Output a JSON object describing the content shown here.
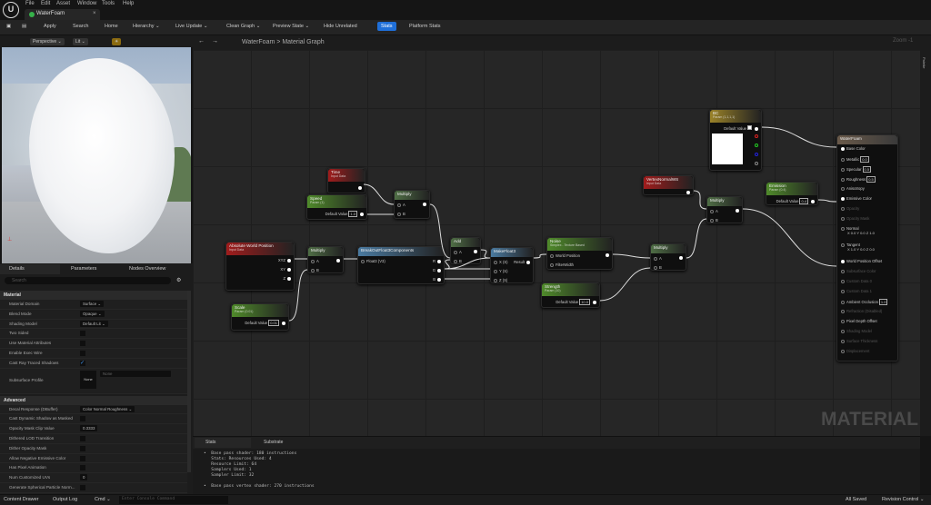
{
  "menu": [
    "File",
    "Edit",
    "Asset",
    "Window",
    "Tools",
    "Help"
  ],
  "tab": {
    "title": "WaterFoam"
  },
  "toolbar": [
    "Apply",
    "Search",
    "Home",
    "Hierarchy ⌄",
    "Live Update ⌄",
    "Clean Graph ⌄",
    "Preview State ⌄",
    "Hide Unrelated"
  ],
  "toolbar_stats": "Stats",
  "toolbar_platform": "Platform Stats",
  "viewport": {
    "perspective": "Perspective ⌄",
    "lit": "Lit ⌄"
  },
  "panels": {
    "details": "Details",
    "parameters": "Parameters",
    "nodes_overview": "Nodes Overview",
    "search_placeholder": "Search"
  },
  "details": {
    "material_section": "Material",
    "material_rows": [
      {
        "label": "Material Domain",
        "value": "Surface ⌄"
      },
      {
        "label": "Blend Mode",
        "value": "Opaque ⌄"
      },
      {
        "label": "Shading Model",
        "value": "Default Lit ⌄"
      },
      {
        "label": "Two Sided",
        "checked": false
      },
      {
        "label": "Use Material Attributes",
        "checked": false
      },
      {
        "label": "Enable Exec Wire",
        "checked": false
      },
      {
        "label": "Cast Ray Traced Shadows",
        "checked": true
      }
    ],
    "subsurface": {
      "label": "Subsurface Profile",
      "thumb": "None",
      "value": "None"
    },
    "advanced_section": "Advanced",
    "advanced_rows": [
      {
        "label": "Decal Response (DBuffer)",
        "value": "Color Normal Roughness ⌄"
      },
      {
        "label": "Cast Dynamic Shadow as Masked",
        "checked": false
      },
      {
        "label": "Opacity Mask Clip Value",
        "value": "0.3333"
      },
      {
        "label": "Dithered LOD Transition",
        "checked": false
      },
      {
        "label": "Dither Opacity Mask",
        "checked": false
      },
      {
        "label": "Allow Negative Emissive Color",
        "checked": false
      },
      {
        "label": "Has Pixel Animation",
        "checked": false
      },
      {
        "label": "Num Customized UVs",
        "value": "0"
      },
      {
        "label": "Generate Spherical Particle Norm...",
        "checked": false
      },
      {
        "label": "Tangent Space Normal",
        "checked": true
      }
    ]
  },
  "graph": {
    "breadcrumb_asset": "WaterFoam",
    "breadcrumb_sep": ">",
    "breadcrumb_graph": "Material Graph",
    "zoom": "Zoom -1",
    "watermark": "MATERIAL",
    "palette": "Palette"
  },
  "nodes": [
    {
      "id": "time",
      "title": "Time",
      "subtitle": "Input Data",
      "color": "#a01c1c"
    },
    {
      "id": "speed",
      "title": "Speed",
      "subtitle": "Param (1)",
      "color": "#4f8a2a",
      "default": "1.0"
    },
    {
      "id": "mul1",
      "title": "Multiply",
      "color": "#4f6e45",
      "pins": [
        "A",
        "B"
      ]
    },
    {
      "id": "awp",
      "title": "Absolute World Position",
      "subtitle": "Input Data",
      "color": "#a01c1c",
      "outs": [
        "XYZ",
        "XY",
        "Z"
      ]
    },
    {
      "id": "mul2",
      "title": "Multiply",
      "color": "#4f6e45",
      "pins": [
        "A",
        "B"
      ]
    },
    {
      "id": "break",
      "title": "BreakOutFloat3Components",
      "color": "#4a7aa0",
      "pins": [
        "Float3 (V3)"
      ],
      "outs": [
        "R",
        "G",
        "B"
      ]
    },
    {
      "id": "scale",
      "title": "Scale",
      "subtitle": "Param (0.01)",
      "color": "#4f8a2a",
      "default": "0.01"
    },
    {
      "id": "add",
      "title": "Add",
      "color": "#4f6e45",
      "pins": [
        "A",
        "B"
      ]
    },
    {
      "id": "make",
      "title": "MakeFloat3",
      "color": "#4a7aa0",
      "pins": [
        "X (S)",
        "Y (S)",
        "Z (S)"
      ],
      "outs": [
        "Result"
      ]
    },
    {
      "id": "noise",
      "title": "Noise",
      "subtitle": "Simplex - Texture Based",
      "color": "#4f8a2a",
      "pins": [
        "World Position",
        "FilterWidth"
      ]
    },
    {
      "id": "strength",
      "title": "Strength",
      "subtitle": "Param (10)",
      "color": "#4f8a2a",
      "default": "10.0"
    },
    {
      "id": "mul3",
      "title": "Multiply",
      "color": "#4f6e45",
      "pins": [
        "A",
        "B"
      ]
    },
    {
      "id": "bc",
      "title": "BC",
      "subtitle": "Param (1,1,1,1)",
      "color": "#9a8228",
      "default": ""
    },
    {
      "id": "vnws",
      "title": "VertexNormalWS",
      "subtitle": "Input Data",
      "color": "#a01c1c"
    },
    {
      "id": "mul4",
      "title": "Multiply",
      "color": "#4f6e45",
      "pins": [
        "A",
        "B"
      ]
    },
    {
      "id": "emission",
      "title": "Emission",
      "subtitle": "Param (0.4)",
      "color": "#4f8a2a",
      "default": "0.4"
    }
  ],
  "default_value_label": "Default Value",
  "result_node": {
    "title": "WaterFoam",
    "pins": [
      {
        "label": "Base Color",
        "on": true
      },
      {
        "label": "Metallic",
        "on": true,
        "v": "0.0"
      },
      {
        "label": "Specular",
        "on": true,
        "v": "0.5"
      },
      {
        "label": "Roughness",
        "on": true,
        "v": "0.5"
      },
      {
        "label": "Anisotropy",
        "on": true
      },
      {
        "label": "Emissive Color",
        "on": true
      },
      {
        "label": "Opacity",
        "on": false
      },
      {
        "label": "Opacity Mask",
        "on": false
      },
      {
        "label": "Normal",
        "on": true,
        "v": "X 0.0 Y 0.0 Z 1.0"
      },
      {
        "label": "Tangent",
        "on": true,
        "v": "X 1.0 Y 0.0 Z 0.0"
      },
      {
        "label": "World Position Offset",
        "on": true
      },
      {
        "label": "Subsurface Color",
        "on": false
      },
      {
        "label": "Custom Data 0",
        "on": false
      },
      {
        "label": "Custom Data 1",
        "on": false
      },
      {
        "label": "Ambient Occlusion",
        "on": true,
        "v": "1.0"
      },
      {
        "label": "Refraction (Disabled)",
        "on": false
      },
      {
        "label": "Pixel Depth Offset",
        "on": true
      },
      {
        "label": "Shading Model",
        "on": false
      },
      {
        "label": "Surface Thickness",
        "on": false
      },
      {
        "label": "Displacement",
        "on": false
      }
    ]
  },
  "stats": {
    "tab_stats": "Stats",
    "tab_substrate": "Substrate",
    "text": "•  Base pass shader: 180 instructions\n   Stats: Resources Used: 4\n   Resource Limit: 64\n   Samplers Used: 1\n   Sampler Limit: 32\n\n•  Base pass vertex shader: 270 instructions"
  },
  "statusbar": {
    "content_drawer": "Content Drawer",
    "output_log": "Output Log",
    "cmd": "Cmd ⌄",
    "console_placeholder": "Enter Console Command",
    "all_saved": "All Saved",
    "revision_control": "Revision Control ⌄"
  }
}
